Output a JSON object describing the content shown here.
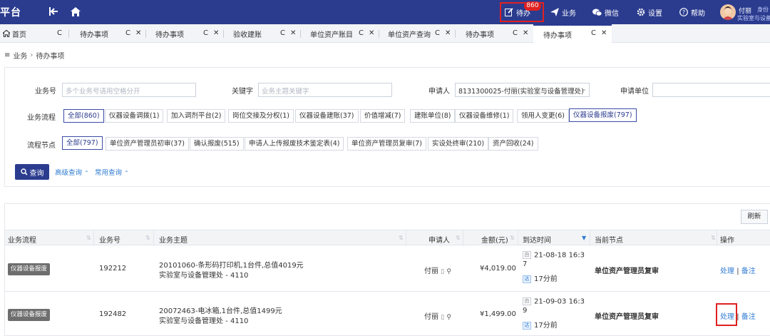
{
  "header": {
    "brand": "平台",
    "nav": [
      {
        "label": "待办",
        "icon": "edit-icon"
      },
      {
        "label": "业务",
        "icon": "send-icon"
      },
      {
        "label": "微信",
        "icon": "wechat-icon"
      },
      {
        "label": "设置",
        "icon": "gear-icon"
      },
      {
        "label": "帮助",
        "icon": "help-icon"
      }
    ],
    "todo_badge": "860",
    "user": {
      "name": "付丽",
      "role": "身份",
      "dept": "实验室与设备"
    }
  },
  "tabs": [
    {
      "label": "首页"
    },
    {
      "label": "待办事项"
    },
    {
      "label": "待办事项"
    },
    {
      "label": "验收建账"
    },
    {
      "label": "单位资产账目"
    },
    {
      "label": "单位资产查询"
    },
    {
      "label": "待办事项"
    },
    {
      "label": "待办事项"
    }
  ],
  "breadcrumb": {
    "root": "业务",
    "sep": "›",
    "current": "待办事项"
  },
  "filters": {
    "biz_no_label": "业务号",
    "biz_no_placeholder": "多个业务号请用空格分开",
    "keyword_label": "关键字",
    "keyword_placeholder": "业务主题关键字",
    "applicant_label": "申请人",
    "applicant_value": "8131300025-付丽(实验室与设备管理处)",
    "unit_label": "申请单位",
    "flow_label": "业务流程",
    "flow_chips": [
      "全部(860)",
      "仪器设备调拨(1)",
      "加入调剂平台(2)",
      "岗位交接及分权(1)",
      "仪器设备建账(37)",
      "价值增减(7)",
      "建账单位(8)",
      "仪器设备维修(1)",
      "领用人变更(6)",
      "仪器设备报废(797)"
    ],
    "node_label": "流程节点",
    "node_chips": [
      "全部(797)",
      "单位资产管理员初审(37)",
      "确认报废(515)",
      "申请人上传报废技术鉴定表(4)",
      "单位资产管理员复审(7)",
      "实设处终审(210)",
      "资产回收(24)"
    ],
    "query_btn": "查询",
    "advanced": "高级查询",
    "common": "常用查询"
  },
  "results": {
    "refresh": "刷新",
    "columns": [
      "业务流程",
      "业务号",
      "业务主题",
      "申请人",
      "金额(元)",
      "到达时间",
      "当前节点",
      "操作"
    ],
    "rows": [
      {
        "flow": "仪器设备报废",
        "biz_no": "192212",
        "subject": "20101060-条形码打印机,1台件,总值4019元",
        "subject_sub": "实验室与设备管理处 - 4110",
        "applicant": "付丽",
        "amount": "¥4,019.00",
        "arrive_tag": "由",
        "arrive_time": "21-08-18 16:3",
        "arrive_time2": "7",
        "elapsed_tag": "达",
        "elapsed": "17分前",
        "node": "单位资产管理员复审",
        "op1": "处理",
        "op_sep": "|",
        "op2": "备注"
      },
      {
        "flow": "仪器设备报废",
        "biz_no": "192482",
        "subject": "20072463-电冰箱,1台件,总值1499元",
        "subject_sub": "实验室与设备管理处 - 4110",
        "applicant": "付丽",
        "amount": "¥1,499.00",
        "arrive_tag": "由",
        "arrive_time": "21-09-03 16:3",
        "arrive_time2": "9",
        "elapsed_tag": "达",
        "elapsed": "17分前",
        "node": "单位资产管理员复审",
        "op1": "处理",
        "op_sep": "|",
        "op2": "备注"
      }
    ]
  },
  "colors": {
    "primary": "#2b3c8f",
    "link": "#2f7bd3",
    "alert": "#e02020"
  }
}
